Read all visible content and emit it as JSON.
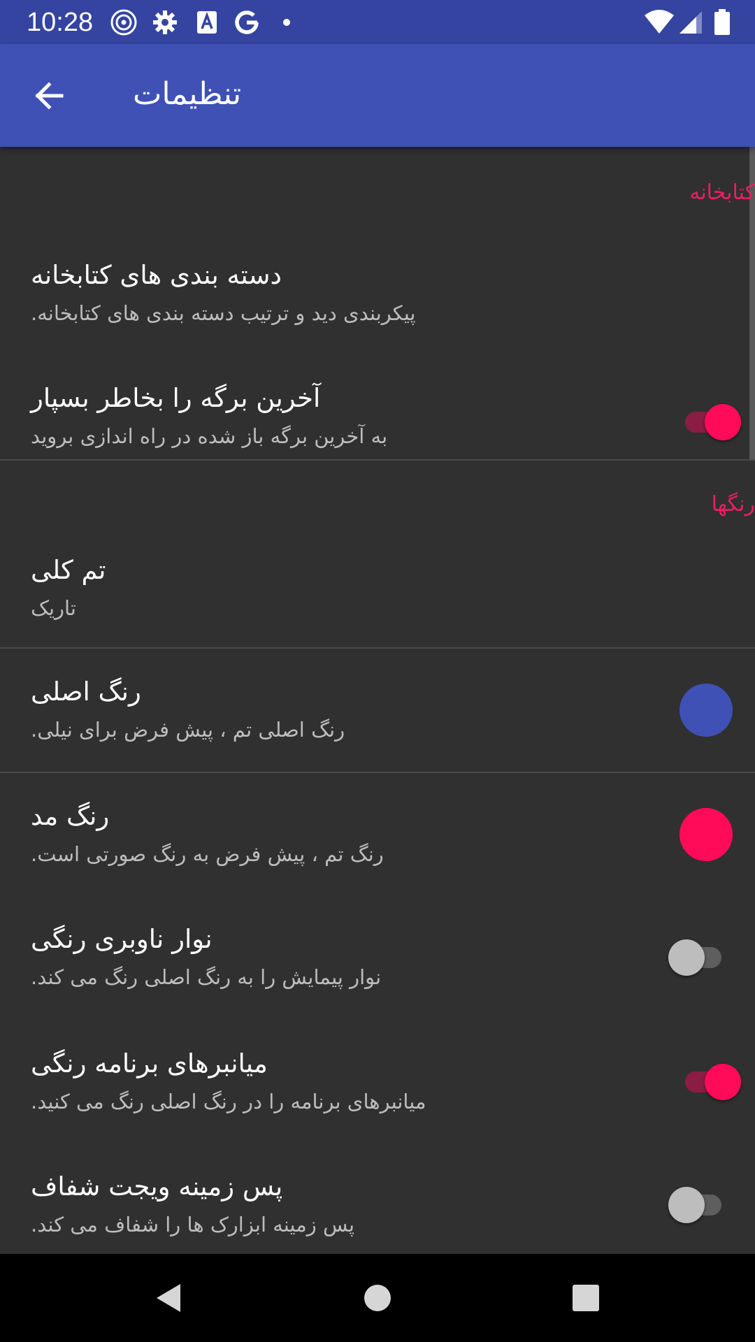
{
  "status_bar": {
    "time": "10:28",
    "icons": [
      "radar-icon",
      "gear-icon",
      "font-a-icon",
      "google-g-icon",
      "dot-icon",
      "wifi-icon",
      "signal-icon",
      "battery-icon"
    ]
  },
  "app_bar": {
    "title": "تنظیمات",
    "back_icon": "arrow-back-icon"
  },
  "sections": [
    {
      "category": "کتابخانه",
      "items": [
        {
          "title": "دسته بندی های کتابخانه",
          "summary": "پیکربندی دید و ترتیب دسته بندی های کتابخانه."
        },
        {
          "title": "آخرین برگه را بخاطر بسپار",
          "summary": "به آخرین برگه باز شده در راه اندازی بروید",
          "switch": true
        }
      ]
    },
    {
      "category": "رنگها",
      "items": [
        {
          "title": "تم کلی",
          "summary": "تاریک"
        },
        {
          "title": "رنگ اصلی",
          "summary": "رنگ اصلی تم ، پیش فرض برای نیلی.",
          "color": "#3f51b5"
        },
        {
          "title": "رنگ مد",
          "summary": "رنگ تم ، پیش فرض به رنگ صورتی است.",
          "color": "#ff0b5a"
        },
        {
          "title": "نوار ناوبری رنگی",
          "summary": "نوار پیمایش را به رنگ اصلی رنگ می کند.",
          "switch": false
        },
        {
          "title": "میانبرهای برنامه رنگی",
          "summary": "میانبرهای برنامه را در رنگ اصلی رنگ می کنید.",
          "switch": true
        },
        {
          "title": "پس زمینه ویجت شفاف",
          "summary": "پس زمینه ابزارک ها را شفاف می کند.",
          "switch": false
        }
      ]
    }
  ],
  "nav_bar": {
    "buttons": [
      "back-triangle-icon",
      "home-circle-icon",
      "recents-square-icon"
    ]
  },
  "colors": {
    "primary": "#3f51b5",
    "primary_dark": "#3544a0",
    "accent": "#ff0b5a",
    "background": "#303030"
  }
}
